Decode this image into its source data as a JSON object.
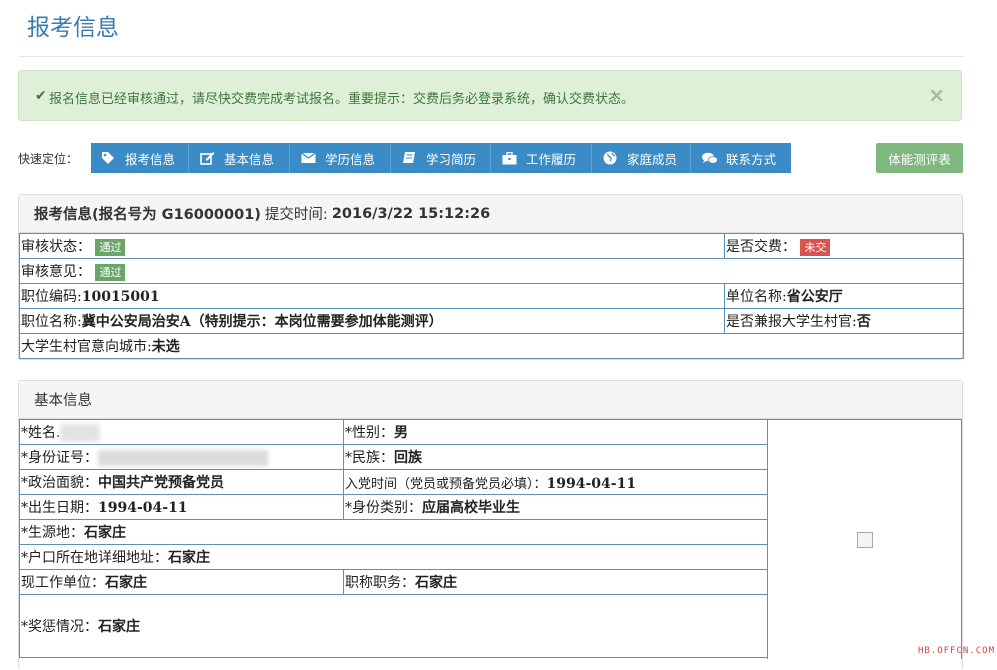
{
  "page_title": "报考信息",
  "alert": {
    "message": "报名信息已经审核通过，请尽快交费完成考试报名。重要提示：交费后务必登录系统，确认交费状态。",
    "close": "×"
  },
  "quick_nav": {
    "label": "快速定位：",
    "items": [
      {
        "label": "报考信息",
        "icon": "tag-icon"
      },
      {
        "label": "基本信息",
        "icon": "edit-icon"
      },
      {
        "label": "学历信息",
        "icon": "envelope-icon"
      },
      {
        "label": "学习简历",
        "icon": "book-icon"
      },
      {
        "label": "工作履历",
        "icon": "briefcase-icon"
      },
      {
        "label": "家庭成员",
        "icon": "globe-icon"
      },
      {
        "label": "联系方式",
        "icon": "comments-icon"
      }
    ],
    "fitness_button": "体能测评表"
  },
  "application_panel": {
    "title_prefix": "报考信息(报名号为 G16000001)",
    "submit_label": "提交时间:",
    "submit_time": "2016/3/22 15:12:26",
    "review_status_label": "审核状态：",
    "review_status": "通过",
    "paid_label": "是否交费：",
    "paid_status": "未交",
    "review_opinion_label": "审核意见：",
    "review_opinion": "通过",
    "position_code_label": "职位编码:",
    "position_code": "10015001",
    "unit_name_label": "单位名称:",
    "unit_name": "省公安厅",
    "position_name_label": "职位名称:",
    "position_name": "冀中公安局治安A（特别提示：本岗位需要参加体能测评）",
    "village_official_label": "是否兼报大学生村官:",
    "village_official": "否",
    "village_city_label": "大学生村官意向城市:",
    "village_city": "未选"
  },
  "basic_panel": {
    "title": "基本信息",
    "name_label": "*姓名.",
    "gender_label": "*性别：",
    "gender": "男",
    "id_label": "*身份证号：",
    "ethnicity_label": "*民族：",
    "ethnicity": "回族",
    "political_label": "*政治面貌：",
    "political": "中国共产党预备党员",
    "party_date_label": "入党时间（党员或预备党员必填）：",
    "party_date": "1994-04-11",
    "birth_label": "*出生日期：",
    "birth": "1994-04-11",
    "identity_type_label": "*身份类别：",
    "identity_type": "应届高校毕业生",
    "origin_label": "*生源地：",
    "origin": "石家庄",
    "address_label": "*户口所在地详细地址：",
    "address": "石家庄",
    "work_unit_label": "现工作单位：",
    "work_unit": "石家庄",
    "title_label": "职称职务：",
    "job_title": "石家庄",
    "awards_label": "*奖惩情况：",
    "awards": "石家庄"
  },
  "watermark": "HB.OFFCN.COM"
}
